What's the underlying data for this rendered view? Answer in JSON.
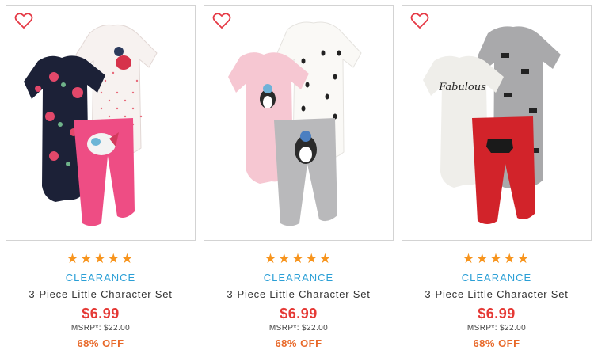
{
  "products": [
    {
      "name": "3-Piece Little Character Set",
      "badge": "CLEARANCE",
      "price": "$6.99",
      "msrp": "MSRP*: $22.00",
      "discount": "68% OFF",
      "rating": 5,
      "icon": "heart-icon",
      "outfit_text": ""
    },
    {
      "name": "3-Piece Little Character Set",
      "badge": "CLEARANCE",
      "price": "$6.99",
      "msrp": "MSRP*: $22.00",
      "discount": "68% OFF",
      "rating": 5,
      "icon": "heart-icon",
      "outfit_text": ""
    },
    {
      "name": "3-Piece Little Character Set",
      "badge": "CLEARANCE",
      "price": "$6.99",
      "msrp": "MSRP*: $22.00",
      "discount": "68% OFF",
      "rating": 5,
      "icon": "heart-icon",
      "outfit_text": "Fabulous"
    }
  ],
  "colors": {
    "star": "#f7941d",
    "badge": "#2a9fd6",
    "price": "#e53935",
    "discount": "#e8692a",
    "heart": "#e53945"
  }
}
